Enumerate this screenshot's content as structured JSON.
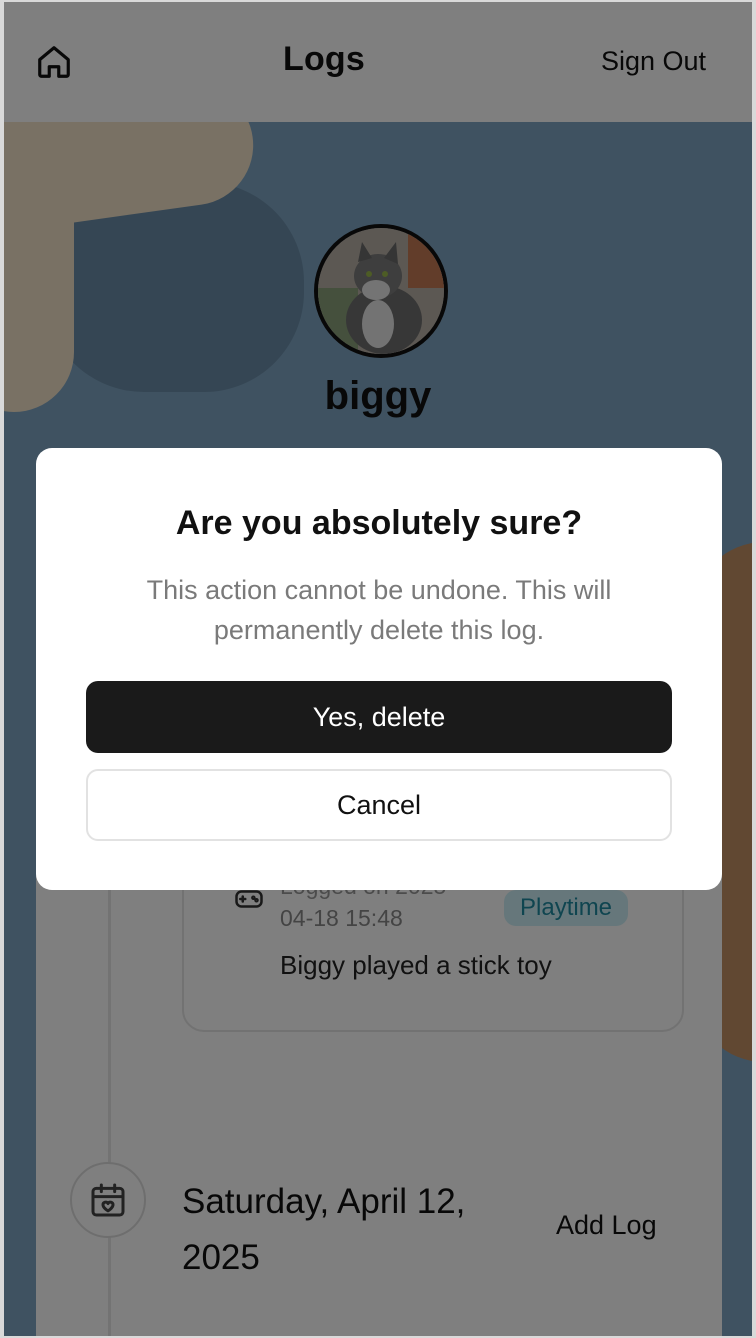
{
  "header": {
    "title": "Logs",
    "sign_out_label": "Sign Out",
    "home_icon": "home-icon"
  },
  "profile": {
    "pet_name": "biggy",
    "avatar_icon": "cat-photo"
  },
  "log_entry": {
    "time_line1": "Logged on 2025",
    "time_line2": "04-18 15:48",
    "category": "Playtime",
    "description": "Biggy played a stick toy",
    "icon": "gamepad-icon"
  },
  "day_section": {
    "date": "Saturday, April 12, 2025",
    "add_log_label": "Add Log",
    "icon": "calendar-heart-icon"
  },
  "dialog": {
    "title": "Are you absolutely sure?",
    "description": "This action cannot be undone. This will permanently delete this log.",
    "confirm_label": "Yes, delete",
    "cancel_label": "Cancel"
  },
  "colors": {
    "primary_button": "#1a1a1a",
    "tag_bg": "#cdeff6",
    "tag_text": "#1f8aa0",
    "overlay": "rgba(0,0,0,0.5)"
  }
}
